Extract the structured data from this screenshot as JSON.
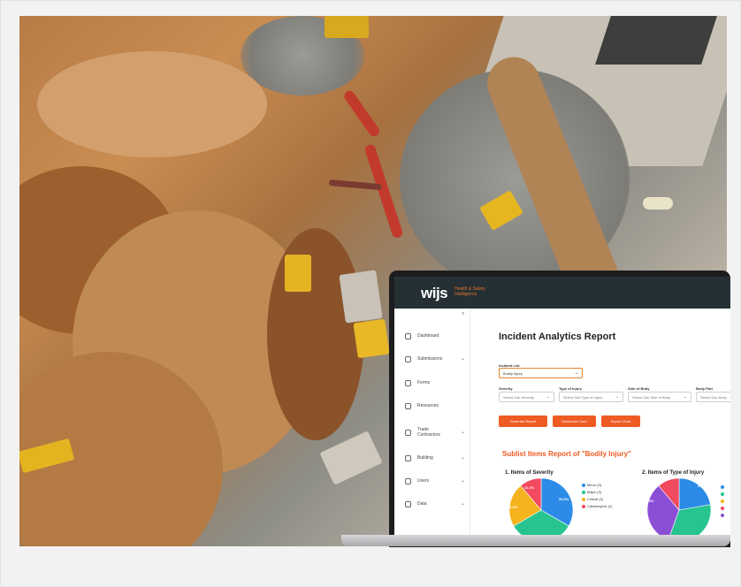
{
  "app": {
    "logo": "wijs",
    "logo_sub": "Health & Safety Intelligence"
  },
  "sidebar": {
    "collapse_glyph": "«",
    "items": [
      {
        "label": "Dashboard",
        "icon": "dashboard-icon",
        "expandable": false
      },
      {
        "label": "Submissions",
        "icon": "submissions-icon",
        "expandable": true
      },
      {
        "label": "Forms",
        "icon": "forms-icon",
        "expandable": false
      },
      {
        "label": "Resources",
        "icon": "resources-icon",
        "expandable": false
      },
      {
        "label": "Trade Contractors",
        "icon": "contractors-icon",
        "expandable": true
      },
      {
        "label": "Building",
        "icon": "building-icon",
        "expandable": true
      },
      {
        "label": "Users",
        "icon": "users-icon",
        "expandable": true
      },
      {
        "label": "Data",
        "icon": "data-icon",
        "expandable": true
      }
    ]
  },
  "report": {
    "title": "Incident Analytics Report",
    "incident_list_label": "Incident List",
    "incident_list_value": "Bodily Injury",
    "filters": [
      {
        "label": "Severity",
        "placeholder": "Select Sub Severity"
      },
      {
        "label": "Type of Injury",
        "placeholder": "Select Sub Type of Injury"
      },
      {
        "label": "Side of Body",
        "placeholder": "Select Sub Side of Body"
      },
      {
        "label": "Body Part",
        "placeholder": "Select Sub Body"
      }
    ],
    "buttons": {
      "generate": "Generate Report",
      "download": "Download Chart",
      "export": "Export Chart"
    },
    "sublist_title": "Sublist Items Report of \"Bodily Injury\""
  },
  "charts": {
    "colors": {
      "blue": "#2b8be6",
      "green": "#27c48f",
      "orange": "#f5b31d",
      "red": "#f24a5f",
      "purple": "#8b4fd6"
    },
    "severity": {
      "title": "1. Items of Severity",
      "labels": [
        "33.3%",
        "11.1%",
        "22.2%"
      ],
      "legend": [
        "Minor (3)",
        "Major (3)",
        "Critical (2)",
        "Catastrophic (1)"
      ]
    },
    "injury": {
      "title": "2. Items of Type of Injury",
      "labels": [
        "22.2%",
        "33.3%"
      ]
    }
  },
  "chart_data": [
    {
      "type": "pie",
      "title": "1. Items of Severity",
      "categories": [
        "Minor",
        "Major",
        "Critical",
        "Catastrophic"
      ],
      "values": [
        3,
        3,
        2,
        1
      ]
    },
    {
      "type": "pie",
      "title": "2. Items of Type of Injury",
      "values": [
        2,
        3,
        3,
        1
      ]
    }
  ]
}
